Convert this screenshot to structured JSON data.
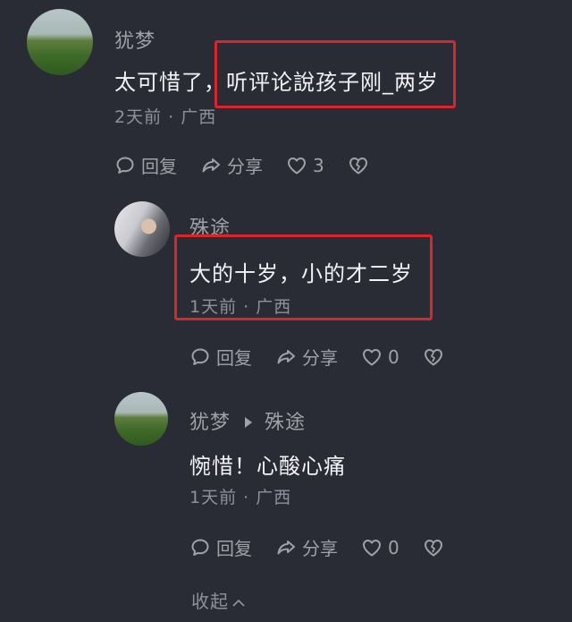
{
  "comments": [
    {
      "username": "犹梦",
      "text": "太可惜了，听评论說孩子刚_两岁",
      "time": "2天前",
      "location": "广西",
      "actions": {
        "reply": "回复",
        "share": "分享",
        "likes": "3"
      }
    },
    {
      "username": "殊途",
      "text": "大的十岁，小的才二岁",
      "time": "1天前",
      "location": "广西",
      "actions": {
        "reply": "回复",
        "share": "分享",
        "likes": "0"
      }
    },
    {
      "username": "犹梦",
      "reply_to": "殊途",
      "text": "惋惜！心酸心痛",
      "time": "1天前",
      "location": "广西",
      "actions": {
        "reply": "回复",
        "share": "分享",
        "likes": "0"
      }
    }
  ],
  "collapse_label": "收起",
  "colors": {
    "background": "#2a2c35",
    "highlight_box": "#d8262c"
  }
}
